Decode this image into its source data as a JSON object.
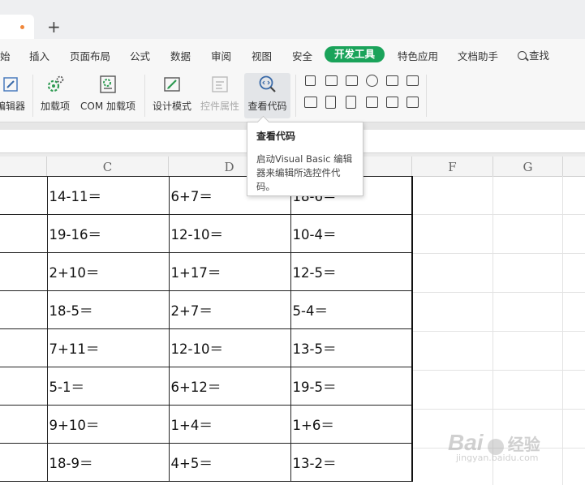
{
  "tabs": {
    "new_tab_symbol": "+"
  },
  "menu": {
    "items": [
      "始",
      "插入",
      "页面布局",
      "公式",
      "数据",
      "审阅",
      "视图",
      "安全",
      "特色应用",
      "文档助手"
    ],
    "active": "开发工具",
    "search_label": "查找",
    "active_color": "#1aa35a"
  },
  "ribbon": {
    "buttons": [
      {
        "label": "编辑器",
        "icon": "editor-icon"
      },
      {
        "label": "加载项",
        "icon": "gear-addin-icon"
      },
      {
        "label": "COM 加载项",
        "icon": "com-addin-icon"
      },
      {
        "label": "设计模式",
        "icon": "design-mode-icon"
      },
      {
        "label": "控件属性",
        "icon": "control-properties-icon",
        "disabled": true
      },
      {
        "label": "查看代码",
        "icon": "view-code-icon",
        "hovered": true
      }
    ],
    "control_icons": [
      "checkbox-icon",
      "textbox-icon",
      "combobox-icon",
      "radio-button-icon",
      "listbox-icon",
      "list-icon",
      "command-button-icon",
      "spin-button-icon",
      "scrollbar-icon",
      "label-icon",
      "image-icon",
      "toggle-icon"
    ]
  },
  "tooltip": {
    "title": "查看代码",
    "line1": "启动Visual Basic 编辑",
    "line2": "器来编辑所选控件代",
    "line3": "码。"
  },
  "columns": [
    "C",
    "D",
    "F",
    "G"
  ],
  "rows": [
    [
      "14-11＝",
      "6+7＝",
      "18-6＝"
    ],
    [
      "19-16＝",
      "12-10＝",
      "10-4＝"
    ],
    [
      "2+10＝",
      "1+17＝",
      "12-5＝"
    ],
    [
      "18-5＝",
      "2+7＝",
      "5-4＝"
    ],
    [
      "7+11＝",
      "12-10＝",
      "13-5＝"
    ],
    [
      "5-1＝",
      "6+12＝",
      "19-5＝"
    ],
    [
      "9+10＝",
      "1+4＝",
      "1+6＝"
    ],
    [
      "18-9＝",
      "4+5＝",
      "13-2＝"
    ]
  ],
  "watermark": {
    "brand": "Bai",
    "cn": "经验",
    "url": "jingyan.baidu.com"
  }
}
